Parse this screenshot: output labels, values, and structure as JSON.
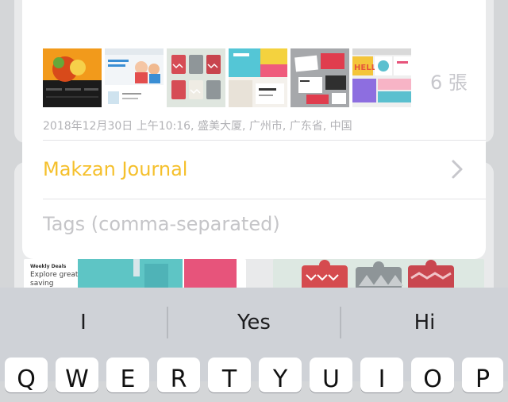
{
  "sheet": {
    "photo_count": "6 張",
    "meta": "2018年12月30日 上午10:16, 盛美大厦, 广州市, 广东省, 中国",
    "journal_name": "Makzan Journal",
    "tags_placeholder": "Tags (comma-separated)",
    "tags_value": ""
  },
  "background_cards": {
    "left": {
      "heading": "Weekly Deals",
      "subtitle": "Explore great saving"
    }
  },
  "keyboard": {
    "suggestions": [
      "I",
      "Yes",
      "Hi"
    ],
    "keys": [
      "Q",
      "W",
      "E",
      "R",
      "T",
      "Y",
      "U",
      "I",
      "O",
      "P"
    ]
  },
  "colors": {
    "accent": "#f5c02c",
    "keyboard_bg": "#cfd2d7",
    "key_bg": "#ffffff"
  }
}
